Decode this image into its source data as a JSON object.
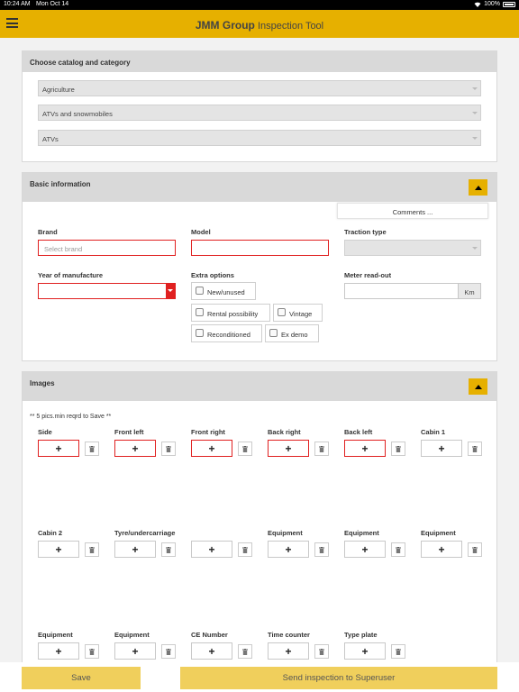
{
  "status_bar": {
    "time": "10:24 AM",
    "date": "Mon Oct 14",
    "battery": "100%"
  },
  "header": {
    "brand": "JMM Group",
    "title": "Inspection Tool"
  },
  "catalog": {
    "heading": "Choose catalog and category",
    "selects": [
      "Agriculture",
      "ATVs and snowmobiles",
      "ATVs"
    ]
  },
  "basic": {
    "heading": "Basic information",
    "comments_label": "Comments ...",
    "brand_label": "Brand",
    "brand_placeholder": "Select brand",
    "model_label": "Model",
    "traction_label": "Traction type",
    "year_label": "Year of manufacture",
    "extra_label": "Extra options",
    "meter_label": "Meter read-out",
    "meter_unit": "Km",
    "options": [
      "New/unused",
      "Rental possibility",
      "Vintage",
      "Reconditioned",
      "Ex demo"
    ]
  },
  "images": {
    "heading": "Images",
    "note": "** 5 pics.min reqrd to Save **",
    "slots": [
      {
        "label": "Side",
        "required": true
      },
      {
        "label": "Front left",
        "required": true
      },
      {
        "label": "Front right",
        "required": true
      },
      {
        "label": "Back right",
        "required": true
      },
      {
        "label": "Back left",
        "required": true
      },
      {
        "label": "Cabin 1",
        "required": false
      },
      {
        "label": "Cabin 2",
        "required": false
      },
      {
        "label": "Tyre/undercarriage",
        "required": false
      },
      {
        "label": "",
        "required": false
      },
      {
        "label": "Equipment",
        "required": false
      },
      {
        "label": "Equipment",
        "required": false
      },
      {
        "label": "Equipment",
        "required": false
      },
      {
        "label": "Equipment",
        "required": false
      },
      {
        "label": "Equipment",
        "required": false
      },
      {
        "label": "CE Number",
        "required": false
      },
      {
        "label": "Time counter",
        "required": false
      },
      {
        "label": "Type plate",
        "required": false
      }
    ],
    "add_glyph": "+"
  },
  "footer": {
    "save_label": "Save",
    "send_label": "Send inspection to Superuser"
  },
  "colors": {
    "accent": "#e6b000",
    "button": "#f0cf5c",
    "error": "#e02020"
  }
}
